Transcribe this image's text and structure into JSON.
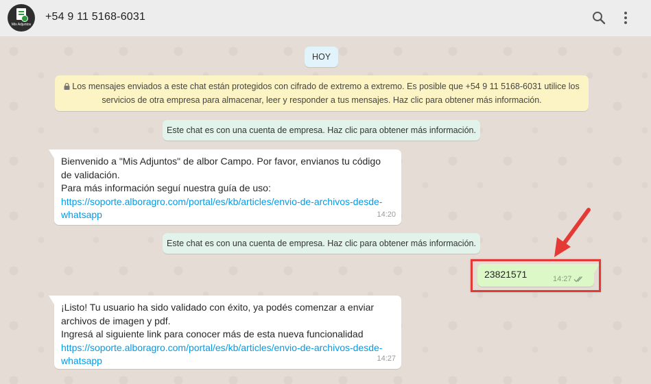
{
  "header": {
    "contact": "+54 9 11 5168-6031",
    "avatar_label": "Mis Adjuntos",
    "icons": [
      "search-icon",
      "menu-dots-icon"
    ]
  },
  "chat": {
    "date_chip": "HOY",
    "encryption_notice": {
      "icon": "lock-icon",
      "line1": "Los mensajes enviados a este chat están protegidos con cifrado de extremo a extremo. Es posible que +54 9 11 5168-6031 utilice los",
      "line2": "servicios de otra empresa para almacenar, leer y responder a tus mensajes. Haz clic para obtener más información."
    },
    "system_chip_1": "Este chat es con una cuenta de empresa. Haz clic para obtener más información.",
    "system_chip_2": "Este chat es con una cuenta de empresa. Haz clic para obtener más información.",
    "messages": [
      {
        "direction": "in",
        "line1": "Bienvenido a \"Mis Adjuntos\" de albor Campo. Por favor, envianos tu código",
        "line2": "de validación.",
        "line3": "Para más información seguí nuestra guía de uso:",
        "link_line1": "https://soporte.alboragro.com/portal/es/kb/articles/envio-de-archivos-desde-",
        "link_line2": "whatsapp",
        "time": "14:20"
      },
      {
        "direction": "out",
        "text": "23821571",
        "time": "14:27",
        "status_icon": "double-check-icon"
      },
      {
        "direction": "in",
        "line1": "¡Listo! Tu usuario ha sido validado con éxito, ya podés comenzar a enviar",
        "line2": "archivos de imagen y pdf.",
        "line3": "Ingresá al siguiente link para conocer más de esta nueva funcionalidad",
        "link_line1": "https://soporte.alboragro.com/portal/es/kb/articles/envio-de-archivos-desde-",
        "link_line2": "whatsapp",
        "time": "14:27"
      }
    ]
  },
  "colors": {
    "header_bg": "#ededed",
    "chat_bg": "#e5ddd5",
    "outgoing_bubble": "#dcf8c6",
    "incoming_bubble": "#ffffff",
    "encryption_bg": "#fcf4c4",
    "system_chip_bg": "#e1f3eb",
    "link": "#039be5",
    "annotation": "#e53935"
  }
}
